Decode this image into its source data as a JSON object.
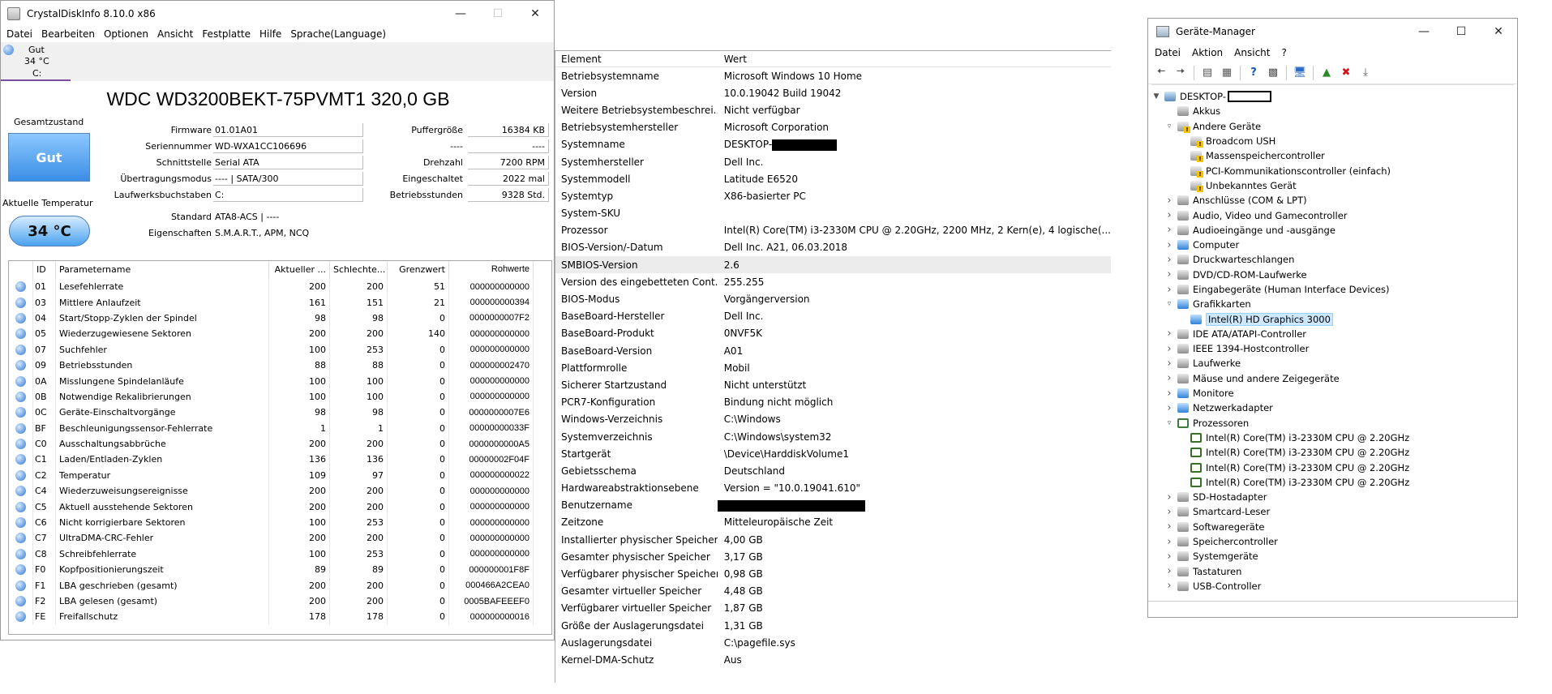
{
  "cdi": {
    "window_title": "CrystalDiskInfo 8.10.0 x86",
    "menu": [
      "Datei",
      "Bearbeiten",
      "Optionen",
      "Ansicht",
      "Festplatte",
      "Hilfe",
      "Sprache(Language)"
    ],
    "drive_tab": {
      "status": "Gut",
      "temp": "34 °C",
      "letter": "C:"
    },
    "model_title": "WDC WD3200BEKT-75PVMT1 320,0 GB",
    "health_label": "Gesamtzustand",
    "health_value": "Gut",
    "temp_label": "Aktuelle Temperatur",
    "temp_value": "34 °C",
    "info_left": [
      {
        "label": "Firmware",
        "value": "01.01A01"
      },
      {
        "label": "Seriennummer",
        "value": "WD-WXA1CC106696"
      },
      {
        "label": "Schnittstelle",
        "value": "Serial ATA"
      },
      {
        "label": "Übertragungsmodus",
        "value": "---- | SATA/300"
      },
      {
        "label": "Laufwerksbuchstaben",
        "value": "C:"
      },
      {
        "label": "Standard",
        "value": "ATA8-ACS | ----"
      },
      {
        "label": "Eigenschaften",
        "value": "S.M.A.R.T., APM, NCQ"
      }
    ],
    "info_right": [
      {
        "label": "Puffergröße",
        "value": "16384 KB"
      },
      {
        "label": "----",
        "value": "----"
      },
      {
        "label": "Drehzahl",
        "value": "7200 RPM"
      },
      {
        "label": "Eingeschaltet",
        "value": "2022 mal"
      },
      {
        "label": "Betriebsstunden",
        "value": "9328 Std."
      }
    ],
    "smart_headers": [
      "ID",
      "Parametername",
      "Aktueller ...",
      "Schlechte...",
      "Grenzwert",
      "Rohwerte"
    ],
    "smart_rows": [
      [
        "01",
        "Lesefehlerrate",
        "200",
        "200",
        "51",
        "000000000000"
      ],
      [
        "03",
        "Mittlere Anlaufzeit",
        "161",
        "151",
        "21",
        "000000000394"
      ],
      [
        "04",
        "Start/Stopp-Zyklen der Spindel",
        "98",
        "98",
        "0",
        "0000000007F2"
      ],
      [
        "05",
        "Wiederzugewiesene Sektoren",
        "200",
        "200",
        "140",
        "000000000000"
      ],
      [
        "07",
        "Suchfehler",
        "100",
        "253",
        "0",
        "000000000000"
      ],
      [
        "09",
        "Betriebsstunden",
        "88",
        "88",
        "0",
        "000000002470"
      ],
      [
        "0A",
        "Misslungene Spindelanläufe",
        "100",
        "100",
        "0",
        "000000000000"
      ],
      [
        "0B",
        "Notwendige Rekalibrierungen",
        "100",
        "100",
        "0",
        "000000000000"
      ],
      [
        "0C",
        "Geräte-Einschaltvorgänge",
        "98",
        "98",
        "0",
        "0000000007E6"
      ],
      [
        "BF",
        "Beschleunigungssensor-Fehlerrate",
        "1",
        "1",
        "0",
        "00000000033F"
      ],
      [
        "C0",
        "Ausschaltungsabbrüche",
        "200",
        "200",
        "0",
        "0000000000A5"
      ],
      [
        "C1",
        "Laden/Entladen-Zyklen",
        "136",
        "136",
        "0",
        "00000002F04F"
      ],
      [
        "C2",
        "Temperatur",
        "109",
        "97",
        "0",
        "000000000022"
      ],
      [
        "C4",
        "Wiederzuweisungsereignisse",
        "200",
        "200",
        "0",
        "000000000000"
      ],
      [
        "C5",
        "Aktuell ausstehende Sektoren",
        "200",
        "200",
        "0",
        "000000000000"
      ],
      [
        "C6",
        "Nicht korrigierbare Sektoren",
        "100",
        "253",
        "0",
        "000000000000"
      ],
      [
        "C7",
        "UltraDMA-CRC-Fehler",
        "200",
        "200",
        "0",
        "000000000000"
      ],
      [
        "C8",
        "Schreibfehlerrate",
        "100",
        "253",
        "0",
        "000000000000"
      ],
      [
        "F0",
        "Kopfpositionierungszeit",
        "89",
        "89",
        "0",
        "000000001F8F"
      ],
      [
        "F1",
        "LBA geschrieben (gesamt)",
        "200",
        "200",
        "0",
        "000466A2CEA0"
      ],
      [
        "F2",
        "LBA gelesen (gesamt)",
        "200",
        "200",
        "0",
        "0005BAFEEEF0"
      ],
      [
        "FE",
        "Freifallschutz",
        "178",
        "178",
        "0",
        "000000000016"
      ]
    ]
  },
  "sysinfo": {
    "headers": [
      "Element",
      "Wert"
    ],
    "rows": [
      [
        "Betriebsystemname",
        "Microsoft Windows 10 Home"
      ],
      [
        "Version",
        "10.0.19042 Build 19042"
      ],
      [
        "Weitere Betriebsystembeschrei...",
        "Nicht verfügbar"
      ],
      [
        "Betriebsystemhersteller",
        "Microsoft Corporation"
      ],
      [
        "Systemname",
        "DESKTOP-"
      ],
      [
        "Systemhersteller",
        "Dell Inc."
      ],
      [
        "Systemmodell",
        "Latitude E6520"
      ],
      [
        "Systemtyp",
        "X86-basierter PC"
      ],
      [
        "System-SKU",
        ""
      ],
      [
        "Prozessor",
        "Intel(R) Core(TM) i3-2330M CPU @ 2.20GHz, 2200 MHz, 2 Kern(e), 4 logische(..."
      ],
      [
        "BIOS-Version/-Datum",
        "Dell Inc. A21, 06.03.2018"
      ],
      [
        "SMBIOS-Version",
        "2.6"
      ],
      [
        "Version des eingebetteten Cont...",
        "255.255"
      ],
      [
        "BIOS-Modus",
        "Vorgängerversion"
      ],
      [
        "BaseBoard-Hersteller",
        "Dell Inc."
      ],
      [
        "BaseBoard-Produkt",
        "0NVF5K"
      ],
      [
        "BaseBoard-Version",
        "A01"
      ],
      [
        "Plattformrolle",
        "Mobil"
      ],
      [
        "Sicherer Startzustand",
        "Nicht unterstützt"
      ],
      [
        "PCR7-Konfiguration",
        "Bindung nicht möglich"
      ],
      [
        "Windows-Verzeichnis",
        "C:\\Windows"
      ],
      [
        "Systemverzeichnis",
        "C:\\Windows\\system32"
      ],
      [
        "Startgerät",
        "\\Device\\HarddiskVolume1"
      ],
      [
        "Gebietsschema",
        "Deutschland"
      ],
      [
        "Hardwareabstraktionsebene",
        "Version = \"10.0.19041.610\""
      ],
      [
        "Benutzername",
        ""
      ],
      [
        "Zeitzone",
        "Mitteleuropäische Zeit"
      ],
      [
        "Installierter physischer Speicher...",
        "4,00 GB"
      ],
      [
        "Gesamter physischer Speicher",
        "3,17 GB"
      ],
      [
        "Verfügbarer physischer Speicher",
        "0,98 GB"
      ],
      [
        "Gesamter virtueller Speicher",
        "4,48 GB"
      ],
      [
        "Verfügbarer virtueller Speicher",
        "1,87 GB"
      ],
      [
        "Größe der Auslagerungsdatei",
        "1,31 GB"
      ],
      [
        "Auslagerungsdatei",
        "C:\\pagefile.sys"
      ],
      [
        "Kernel-DMA-Schutz",
        "Aus"
      ]
    ]
  },
  "devmgr": {
    "window_title": "Geräte-Manager",
    "menu": [
      "Datei",
      "Aktion",
      "Ansicht",
      "?"
    ],
    "root": "DESKTOP-",
    "tree": [
      {
        "level": 1,
        "exp": "",
        "icon": "gray",
        "label": "Akkus"
      },
      {
        "level": 1,
        "exp": "open",
        "icon": "warn",
        "label": "Andere Geräte"
      },
      {
        "level": 2,
        "exp": "none",
        "icon": "warn",
        "label": "Broadcom USH"
      },
      {
        "level": 2,
        "exp": "none",
        "icon": "warn",
        "label": "Massenspeichercontroller"
      },
      {
        "level": 2,
        "exp": "none",
        "icon": "warn",
        "label": "PCI-Kommunikationscontroller (einfach)"
      },
      {
        "level": 2,
        "exp": "none",
        "icon": "warn",
        "label": "Unbekanntes Gerät"
      },
      {
        "level": 1,
        "exp": "closed",
        "icon": "gray",
        "label": "Anschlüsse (COM & LPT)"
      },
      {
        "level": 1,
        "exp": "closed",
        "icon": "gray",
        "label": "Audio, Video und Gamecontroller"
      },
      {
        "level": 1,
        "exp": "closed",
        "icon": "gray",
        "label": "Audioeingänge und -ausgänge"
      },
      {
        "level": 1,
        "exp": "closed",
        "icon": "blue",
        "label": "Computer"
      },
      {
        "level": 1,
        "exp": "closed",
        "icon": "gray",
        "label": "Druckwarteschlangen"
      },
      {
        "level": 1,
        "exp": "closed",
        "icon": "gray",
        "label": "DVD/CD-ROM-Laufwerke"
      },
      {
        "level": 1,
        "exp": "closed",
        "icon": "gray",
        "label": "Eingabegeräte (Human Interface Devices)"
      },
      {
        "level": 1,
        "exp": "open",
        "icon": "blue",
        "label": "Grafikkarten"
      },
      {
        "level": 2,
        "exp": "none",
        "icon": "blue",
        "label": "Intel(R) HD Graphics 3000",
        "selected": true
      },
      {
        "level": 1,
        "exp": "closed",
        "icon": "gray",
        "label": "IDE ATA/ATAPI-Controller"
      },
      {
        "level": 1,
        "exp": "closed",
        "icon": "gray",
        "label": "IEEE 1394-Hostcontroller"
      },
      {
        "level": 1,
        "exp": "closed",
        "icon": "gray",
        "label": "Laufwerke"
      },
      {
        "level": 1,
        "exp": "closed",
        "icon": "gray",
        "label": "Mäuse und andere Zeigegeräte"
      },
      {
        "level": 1,
        "exp": "closed",
        "icon": "blue",
        "label": "Monitore"
      },
      {
        "level": 1,
        "exp": "closed",
        "icon": "blue",
        "label": "Netzwerkadapter"
      },
      {
        "level": 1,
        "exp": "open",
        "icon": "green",
        "label": "Prozessoren"
      },
      {
        "level": 2,
        "exp": "none",
        "icon": "chip",
        "label": "Intel(R) Core(TM) i3-2330M CPU @ 2.20GHz"
      },
      {
        "level": 2,
        "exp": "none",
        "icon": "chip",
        "label": "Intel(R) Core(TM) i3-2330M CPU @ 2.20GHz"
      },
      {
        "level": 2,
        "exp": "none",
        "icon": "chip",
        "label": "Intel(R) Core(TM) i3-2330M CPU @ 2.20GHz"
      },
      {
        "level": 2,
        "exp": "none",
        "icon": "chip",
        "label": "Intel(R) Core(TM) i3-2330M CPU @ 2.20GHz"
      },
      {
        "level": 1,
        "exp": "closed",
        "icon": "gray",
        "label": "SD-Hostadapter"
      },
      {
        "level": 1,
        "exp": "closed",
        "icon": "gray",
        "label": "Smartcard-Leser"
      },
      {
        "level": 1,
        "exp": "closed",
        "icon": "gray",
        "label": "Softwaregeräte"
      },
      {
        "level": 1,
        "exp": "closed",
        "icon": "gray",
        "label": "Speichercontroller"
      },
      {
        "level": 1,
        "exp": "closed",
        "icon": "gray",
        "label": "Systemgeräte"
      },
      {
        "level": 1,
        "exp": "closed",
        "icon": "gray",
        "label": "Tastaturen"
      },
      {
        "level": 1,
        "exp": "closed",
        "icon": "gray",
        "label": "USB-Controller"
      }
    ]
  }
}
